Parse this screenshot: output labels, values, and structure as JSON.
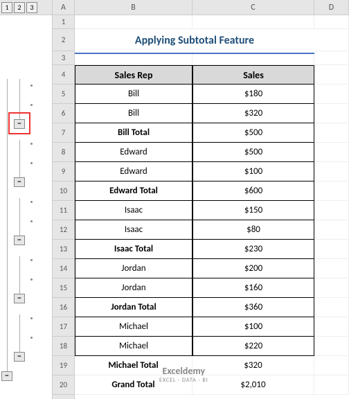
{
  "outline_levels": [
    "1",
    "2",
    "3"
  ],
  "columns": {
    "A": "A",
    "B": "B",
    "C": "C",
    "D": "D"
  },
  "rows": [
    "1",
    "2",
    "3",
    "4",
    "5",
    "6",
    "7",
    "8",
    "9",
    "10",
    "11",
    "12",
    "13",
    "14",
    "15",
    "16",
    "17",
    "18",
    "19",
    "20"
  ],
  "title": "Applying Subtotal Feature",
  "headers": {
    "rep": "Sales Rep",
    "sales": "Sales"
  },
  "data": [
    {
      "rep": "Bill",
      "sales": "$180",
      "type": "data"
    },
    {
      "rep": "Bill",
      "sales": "$320",
      "type": "data"
    },
    {
      "rep": "Bill Total",
      "sales": "$500",
      "type": "subtotal"
    },
    {
      "rep": "Edward",
      "sales": "$500",
      "type": "data"
    },
    {
      "rep": "Edward",
      "sales": "$100",
      "type": "data"
    },
    {
      "rep": "Edward Total",
      "sales": "$600",
      "type": "subtotal"
    },
    {
      "rep": "Isaac",
      "sales": "$150",
      "type": "data"
    },
    {
      "rep": "Isaac",
      "sales": "$80",
      "type": "data"
    },
    {
      "rep": "Isaac Total",
      "sales": "$230",
      "type": "subtotal"
    },
    {
      "rep": "Jordan",
      "sales": "$200",
      "type": "data"
    },
    {
      "rep": "Jordan",
      "sales": "$160",
      "type": "data"
    },
    {
      "rep": "Jordan  Total",
      "sales": "$360",
      "type": "subtotal"
    },
    {
      "rep": "Michael",
      "sales": "$100",
      "type": "data"
    },
    {
      "rep": "Michael",
      "sales": "$220",
      "type": "data"
    },
    {
      "rep": "Michael Total",
      "sales": "$320",
      "type": "subtotal"
    },
    {
      "rep": "Grand Total",
      "sales": "$2,010",
      "type": "grand"
    }
  ],
  "toggle_symbol": "−",
  "watermark": {
    "title": "Exceldemy",
    "sub": "EXCEL · DATA · BI"
  }
}
